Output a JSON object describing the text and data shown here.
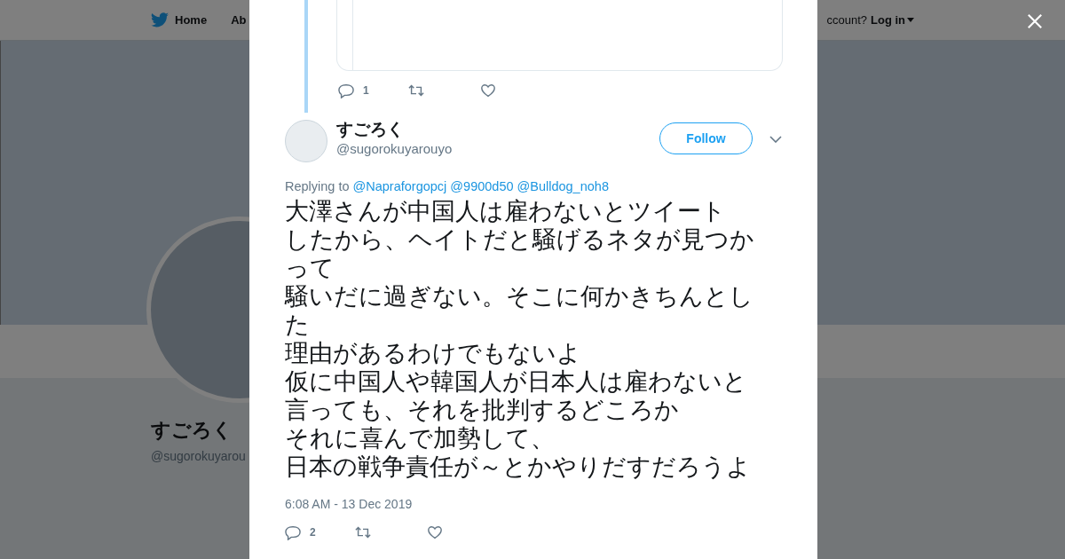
{
  "nav": {
    "home": "Home",
    "about": "Ab",
    "account_prompt": "ccount?",
    "login": "Log in"
  },
  "profile": {
    "name": "すごろく",
    "handle": "@sugorokuyarou"
  },
  "dialog": {
    "previous_tweet": {
      "reply_count": "1"
    },
    "tweet": {
      "name": "すごろく",
      "handle": "@sugorokuyarouyo",
      "follow": "Follow",
      "replying_to": "Replying to",
      "mentions": [
        "@Napraforgopcj",
        "@9900d50",
        "@Bulldog_noh8"
      ],
      "text_lines": [
        "大澤さんが中国人は雇わないとツイート",
        "したから、ヘイトだと騒げるネタが見つかって",
        "騒いだに過ぎない。そこに何かきちんとした",
        "理由があるわけでもないよ",
        "仮に中国人や韓国人が日本人は雇わないと",
        "言っても、それを批判するどころか",
        "それに喜んで加勢して、",
        "日本の戦争責任が～とかやりだすだろうよ"
      ],
      "timestamp": "6:08 AM - 13 Dec 2019",
      "reply_count": "2"
    }
  }
}
